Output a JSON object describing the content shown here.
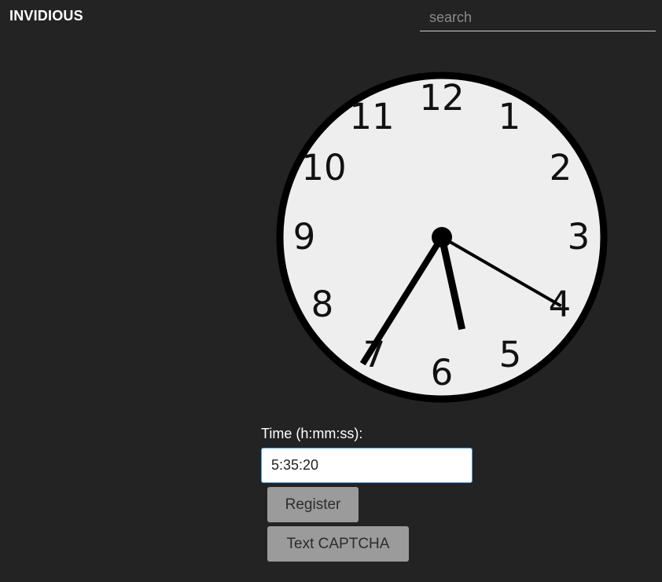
{
  "header": {
    "brand": "INVIDIOUS",
    "search_placeholder": "search"
  },
  "clock": {
    "numerals": [
      "12",
      "1",
      "2",
      "3",
      "4",
      "5",
      "6",
      "7",
      "8",
      "9",
      "10",
      "11"
    ],
    "time": {
      "hour": 5,
      "minute": 35,
      "second": 20
    },
    "face_color": "#eeeeee",
    "rim_color": "#000000"
  },
  "form": {
    "time_label": "Time (h:mm:ss):",
    "time_value": "5:35:20",
    "register_label": "Register",
    "text_captcha_label": "Text CAPTCHA"
  }
}
